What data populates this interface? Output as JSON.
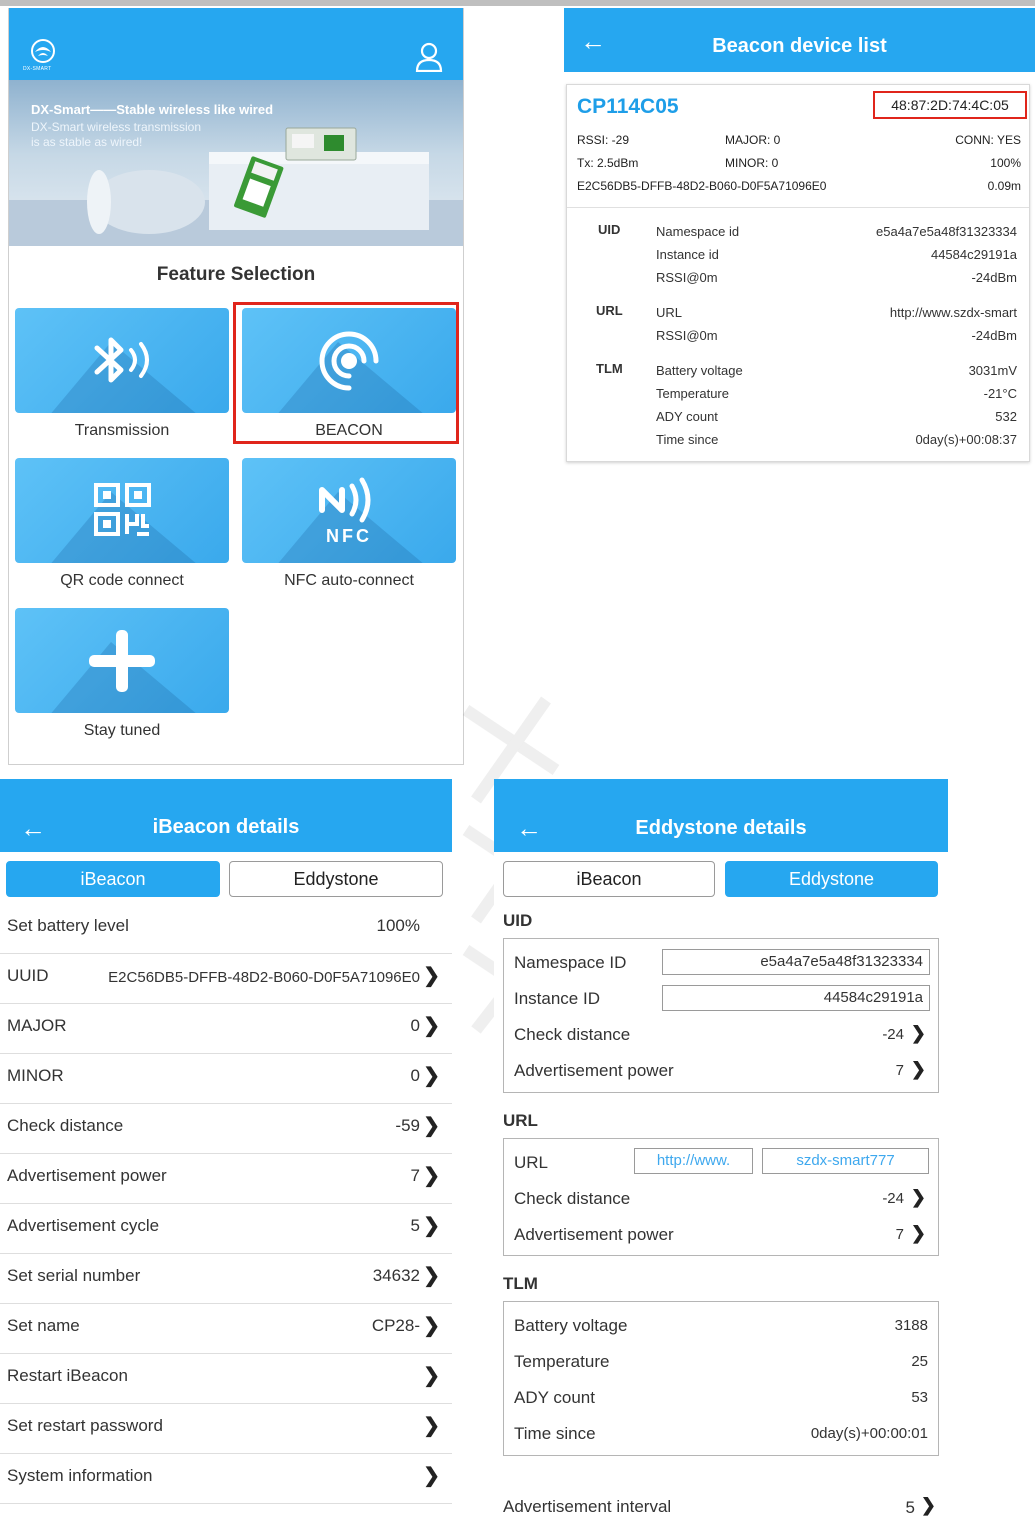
{
  "feature_app": {
    "logo_text": "DX-SMART",
    "banner": {
      "headline": "DX-Smart——Stable wireless like wired",
      "subline_1": "DX-Smart wireless transmission",
      "subline_2": "is as stable as wired!"
    },
    "section_title": "Feature Selection",
    "tiles": [
      {
        "label": "Transmission",
        "icon": "bluetooth-icon"
      },
      {
        "label": "BEACON",
        "icon": "beacon-signal-icon"
      },
      {
        "label": "QR code connect",
        "icon": "qr-code-icon"
      },
      {
        "label": "NFC auto-connect",
        "icon": "nfc-icon",
        "icon_text": "NFC"
      },
      {
        "label": "Stay tuned",
        "icon": "plus-icon"
      }
    ]
  },
  "device_list": {
    "title": "Beacon device list",
    "device": {
      "name": "CP114C05",
      "mac": "48:87:2D:74:4C:05",
      "rssi": "RSSI: -29",
      "major": "MAJOR: 0",
      "conn": "CONN: YES",
      "tx": "Tx: 2.5dBm",
      "minor": "MINOR: 0",
      "battery": "100%",
      "uuid": "E2C56DB5-DFFB-48D2-B060-D0F5A71096E0",
      "distance": "0.09m",
      "uid": {
        "label": "UID",
        "rows": [
          {
            "k": "Namespace id",
            "v": "e5a4a7e5a48f31323334"
          },
          {
            "k": "Instance id",
            "v": "44584c29191a"
          },
          {
            "k": "RSSI@0m",
            "v": "-24dBm"
          }
        ]
      },
      "url": {
        "label": "URL",
        "rows": [
          {
            "k": "URL",
            "v": "http://www.szdx-smart"
          },
          {
            "k": "RSSI@0m",
            "v": "-24dBm"
          }
        ]
      },
      "tlm": {
        "label": "TLM",
        "rows": [
          {
            "k": "Battery voltage",
            "v": "3031mV"
          },
          {
            "k": "Temperature",
            "v": "-21°C"
          },
          {
            "k": "ADY count",
            "v": "532"
          },
          {
            "k": "Time since",
            "v": "0day(s)+00:08:37"
          }
        ]
      }
    }
  },
  "ibeacon": {
    "title": "iBeacon details",
    "tabs": [
      "iBeacon",
      "Eddystone"
    ],
    "rows": [
      {
        "label": "Set battery level",
        "value": "100%"
      },
      {
        "label": "UUID",
        "value": "E2C56DB5-DFFB-48D2-B060-D0F5A71096E0"
      },
      {
        "label": "MAJOR",
        "value": "0"
      },
      {
        "label": "MINOR",
        "value": "0"
      },
      {
        "label": "Check distance",
        "value": "-59"
      },
      {
        "label": "Advertisement power",
        "value": "7"
      },
      {
        "label": "Advertisement cycle",
        "value": "5"
      },
      {
        "label": "Set serial number",
        "value": "34632"
      },
      {
        "label": "Set name",
        "value": "CP28-"
      },
      {
        "label": "Restart iBeacon",
        "value": ""
      },
      {
        "label": "Set restart password",
        "value": ""
      },
      {
        "label": "System information",
        "value": ""
      }
    ]
  },
  "eddystone": {
    "title": "Eddystone details",
    "tabs": [
      "iBeacon",
      "Eddystone"
    ],
    "uid": {
      "title": "UID",
      "namespace_label": "Namespace ID",
      "namespace_value": "e5a4a7e5a48f31323334",
      "instance_label": "Instance ID",
      "instance_value": "44584c29191a",
      "distance_label": "Check distance",
      "distance_value": "-24",
      "power_label": "Advertisement power",
      "power_value": "7"
    },
    "url": {
      "title": "URL",
      "url_label": "URL",
      "prefix_value": "http://www.",
      "suffix_value": "szdx-smart777",
      "distance_label": "Check distance",
      "distance_value": "-24",
      "power_label": "Advertisement power",
      "power_value": "7"
    },
    "tlm": {
      "title": "TLM",
      "rows": [
        {
          "k": "Battery voltage",
          "v": "3188"
        },
        {
          "k": "Temperature",
          "v": "25"
        },
        {
          "k": "ADY count",
          "v": "53"
        },
        {
          "k": "Time since",
          "v": "0day(s)+00:00:01"
        }
      ]
    },
    "interval_label": "Advertisement interval",
    "interval_value": "5"
  },
  "colors": {
    "header_blue": "#26a7f0",
    "highlight_red": "#e0251b",
    "device_name_blue": "#1e9ee8"
  }
}
